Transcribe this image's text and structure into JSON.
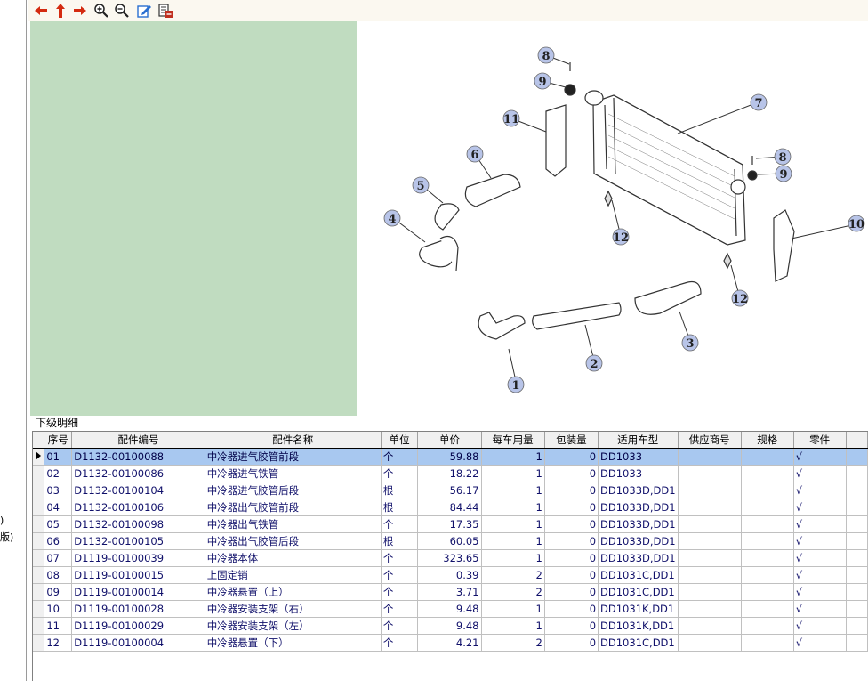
{
  "left_fragments": [
    ")",
    "版)"
  ],
  "toolbar": {
    "buttons": [
      {
        "name": "back-icon"
      },
      {
        "name": "up-icon"
      },
      {
        "name": "forward-icon"
      },
      {
        "name": "zoom-in-icon"
      },
      {
        "name": "zoom-out-icon"
      },
      {
        "name": "edit-icon"
      },
      {
        "name": "export-icon"
      }
    ]
  },
  "diagram": {
    "callouts": [
      "1",
      "2",
      "3",
      "4",
      "5",
      "6",
      "7",
      "8",
      "9",
      "8",
      "9",
      "10",
      "11",
      "12",
      "12"
    ]
  },
  "detail": {
    "title": "下级明细",
    "columns": [
      "序号",
      "配件编号",
      "配件名称",
      "单位",
      "单价",
      "每车用量",
      "包装量",
      "适用车型",
      "供应商号",
      "规格",
      "零件"
    ],
    "selected_row": 0,
    "rows": [
      [
        "01",
        "D1132-00100088",
        "中冷器进气胶管前段",
        "个",
        "59.88",
        "1",
        "0",
        "DD1033",
        "",
        "",
        "√"
      ],
      [
        "02",
        "D1132-00100086",
        "中冷器进气铁管",
        "个",
        "18.22",
        "1",
        "0",
        "DD1033",
        "",
        "",
        "√"
      ],
      [
        "03",
        "D1132-00100104",
        "中冷器进气胶管后段",
        "根",
        "56.17",
        "1",
        "0",
        "DD1033D,DD1",
        "",
        "",
        "√"
      ],
      [
        "04",
        "D1132-00100106",
        "中冷器出气胶管前段",
        "根",
        "84.44",
        "1",
        "0",
        "DD1033D,DD1",
        "",
        "",
        "√"
      ],
      [
        "05",
        "D1132-00100098",
        "中冷器出气铁管",
        "个",
        "17.35",
        "1",
        "0",
        "DD1033D,DD1",
        "",
        "",
        "√"
      ],
      [
        "06",
        "D1132-00100105",
        "中冷器出气胶管后段",
        "根",
        "60.05",
        "1",
        "0",
        "DD1033D,DD1",
        "",
        "",
        "√"
      ],
      [
        "07",
        "D1119-00100039",
        "中冷器本体",
        "个",
        "323.65",
        "1",
        "0",
        "DD1033D,DD1",
        "",
        "",
        "√"
      ],
      [
        "08",
        "D1119-00100015",
        "上固定销",
        "个",
        "0.39",
        "2",
        "0",
        "DD1031C,DD1",
        "",
        "",
        "√"
      ],
      [
        "09",
        "D1119-00100014",
        "中冷器悬置（上）",
        "个",
        "3.71",
        "2",
        "0",
        "DD1031C,DD1",
        "",
        "",
        "√"
      ],
      [
        "10",
        "D1119-00100028",
        "中冷器安装支架（右）",
        "个",
        "9.48",
        "1",
        "0",
        "DD1031K,DD1",
        "",
        "",
        "√"
      ],
      [
        "11",
        "D1119-00100029",
        "中冷器安装支架（左）",
        "个",
        "9.48",
        "1",
        "0",
        "DD1031K,DD1",
        "",
        "",
        "√"
      ],
      [
        "12",
        "D1119-00100004",
        "中冷器悬置（下）",
        "个",
        "4.21",
        "2",
        "0",
        "DD1031C,DD1",
        "",
        "",
        "√"
      ]
    ]
  }
}
